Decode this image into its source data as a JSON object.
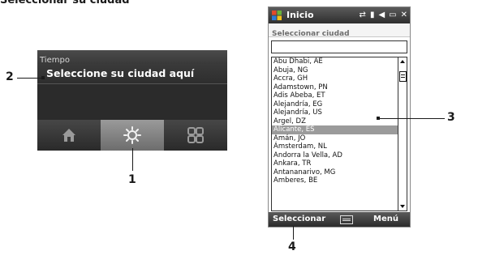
{
  "heading": "Seleccionar su ciudad",
  "weather_widget": {
    "title": "Tiempo",
    "city_prompt": "Seleccione su ciudad aquí",
    "tabs": [
      {
        "icon": "home-icon"
      },
      {
        "icon": "sun-icon",
        "selected": true
      },
      {
        "icon": "grid-icon"
      }
    ]
  },
  "phone": {
    "status_title": "Inicio",
    "status_icons": [
      "sync-icon",
      "signal-icon",
      "volume-icon",
      "battery-icon",
      "close-icon"
    ],
    "page_title": "Seleccionar ciudad",
    "search_value": "",
    "cities": [
      "Abu Dhabi, AE",
      "Abuja, NG",
      "Accra, GH",
      "Adamstown, PN",
      "Adis Abeba, ET",
      "Alejandría, EG",
      "Alejandría, US",
      "Argel, DZ",
      "Alicante, ES",
      "Amán, JO",
      "Ámsterdam, NL",
      "Andorra la Vella, AD",
      "Ankara, TR",
      "Antananarivo, MG",
      "Amberes, BE"
    ],
    "selected_city": "Alicante, ES",
    "softkeys": {
      "left": "Seleccionar",
      "right": "Menú"
    }
  },
  "callouts": [
    "1",
    "2",
    "3",
    "4"
  ]
}
